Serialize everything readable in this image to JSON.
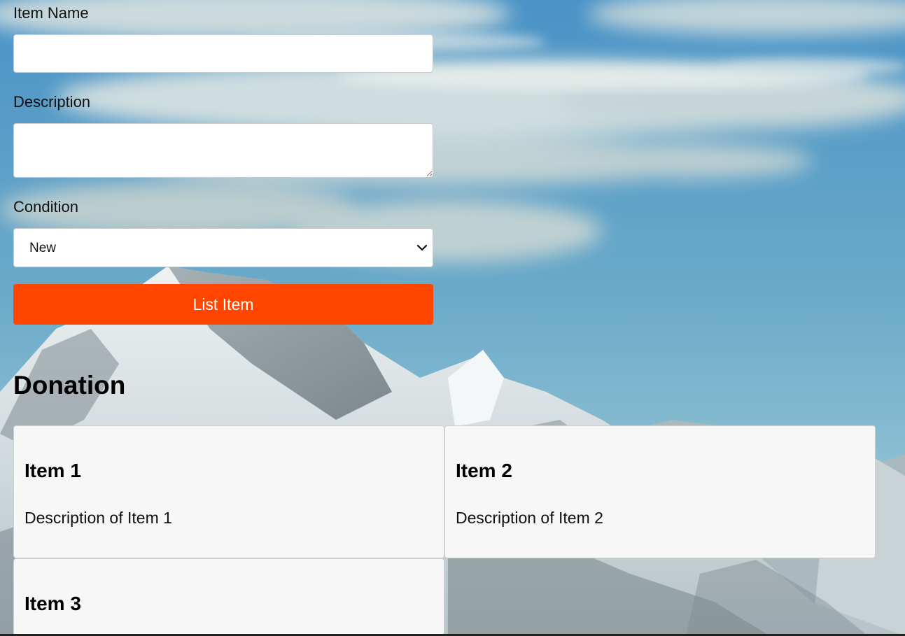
{
  "form": {
    "item_name": {
      "label": "Item Name",
      "value": ""
    },
    "description": {
      "label": "Description",
      "value": ""
    },
    "condition": {
      "label": "Condition",
      "selected": "New"
    },
    "submit_label": "List Item"
  },
  "donation": {
    "heading": "Donation",
    "items": [
      {
        "title": "Item 1",
        "description": "Description of Item 1"
      },
      {
        "title": "Item 2",
        "description": "Description of Item 2"
      },
      {
        "title": "Item 3",
        "description": ""
      }
    ]
  },
  "theme": {
    "accent": "#ff4500",
    "card_background": "#f7f7f7"
  }
}
